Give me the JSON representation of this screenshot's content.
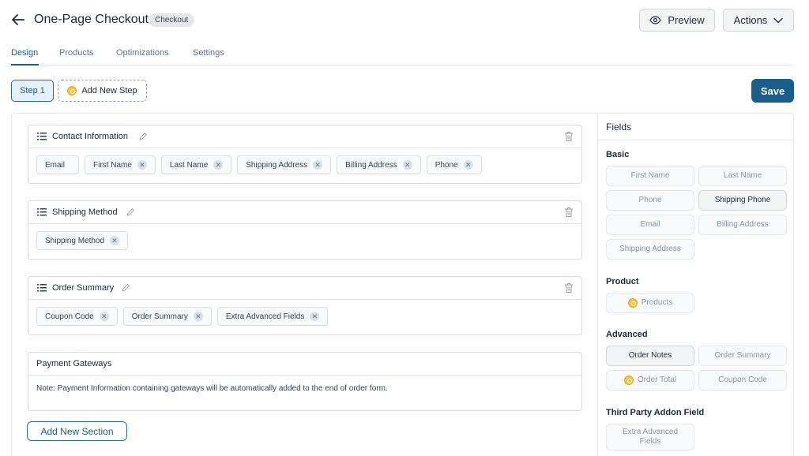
{
  "header": {
    "title": "One-Page Checkout",
    "badge": "Checkout",
    "preview_label": "Preview",
    "actions_label": "Actions"
  },
  "tabs": [
    {
      "label": "Design",
      "active": true
    },
    {
      "label": "Products",
      "active": false
    },
    {
      "label": "Optimizations",
      "active": false
    },
    {
      "label": "Settings",
      "active": false
    }
  ],
  "steps": {
    "current": "Step 1",
    "add_label": "Add New Step"
  },
  "save_label": "Save",
  "sections": [
    {
      "title": "Contact Information",
      "fields": [
        "Email",
        "First Name",
        "Last Name",
        "Shipping Address",
        "Billing Address",
        "Phone"
      ]
    },
    {
      "title": "Shipping Method",
      "fields": [
        "Shipping Method"
      ]
    },
    {
      "title": "Order Summary",
      "fields": [
        "Coupon Code",
        "Order Summary",
        "Extra Advanced Fields"
      ]
    }
  ],
  "payment": {
    "title": "Payment Gateways",
    "note": "Note: Payment Information containing gateways will be automatically added to the end of order form."
  },
  "add_section_label": "Add New Section",
  "fields_panel": {
    "title": "Fields",
    "groups": [
      {
        "label": "Basic",
        "items": [
          "First Name",
          "Last Name",
          "Phone",
          "Shipping Phone",
          "Email",
          "Billing Address",
          "Shipping Address"
        ]
      },
      {
        "label": "Product",
        "items": [
          "Products"
        ]
      },
      {
        "label": "Advanced",
        "items": [
          "Order Notes",
          "Order Summary",
          "Order Total",
          "Coupon Code"
        ]
      },
      {
        "label": "Third Party Addon Field",
        "items": [
          "Extra Advanced Fields"
        ]
      }
    ]
  },
  "colors": {
    "accent": "#1a5c8a",
    "premium_coin": "#f5c24a"
  },
  "icons": {
    "back": "arrow-left-icon",
    "preview": "eye-icon",
    "actions": "chevron-down-icon",
    "drag": "drag-handle-icon",
    "edit": "pencil-icon",
    "delete": "trash-icon",
    "remove": "close-icon",
    "premium": "coin-icon"
  }
}
